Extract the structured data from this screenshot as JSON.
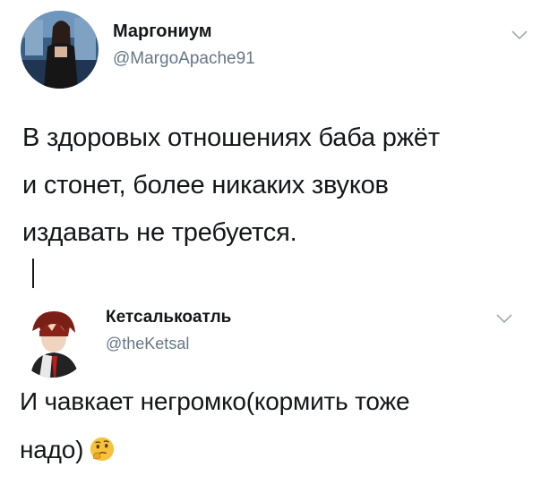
{
  "tweets": [
    {
      "author_name": "Маргониум",
      "author_handle": "@MargoApache91",
      "text_lines": [
        "В здоровых отношениях баба ржёт",
        "и стонет, более никаких звуков",
        "издавать не требуется."
      ]
    },
    {
      "author_name": "Кетсалькоатль",
      "author_handle": "@theKetsal",
      "text_lines": [
        "И чавкает негромко(кормить тоже",
        "надо)"
      ],
      "emoji": "thinking-face"
    }
  ],
  "colors": {
    "text": "#14171a",
    "secondary": "#657786",
    "chevron": "#a0aab3"
  },
  "icons": {
    "menu": "chevron-down-icon",
    "emoji": "thinking-face-emoji-icon"
  }
}
